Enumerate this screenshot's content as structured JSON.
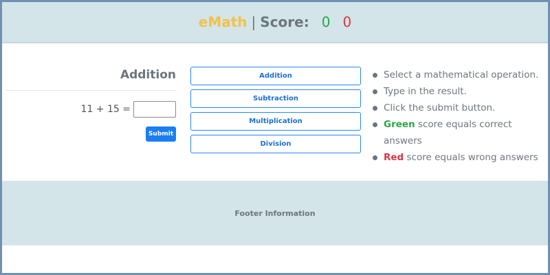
{
  "header": {
    "brand": "eMath",
    "separator": "|",
    "score_label": "Score:",
    "score_correct": "0",
    "score_wrong": "0"
  },
  "exercise": {
    "operation_title": "Addition",
    "problem": "11 + 15 =",
    "answer_value": "",
    "submit_label": "Submit"
  },
  "operations": [
    {
      "label": "Addition"
    },
    {
      "label": "Subtraction"
    },
    {
      "label": "Multiplication"
    },
    {
      "label": "Division"
    }
  ],
  "instructions": {
    "step1": "Select a mathematical operation.",
    "step2": "Type in the result.",
    "step3": "Click the submit button.",
    "green_word": "Green",
    "green_rest": " score equals correct answers",
    "red_word": "Red",
    "red_rest": " score equals wrong answers"
  },
  "footer": {
    "text": "Footer Information"
  },
  "colors": {
    "brand": "#f2c14a",
    "correct": "#28a745",
    "wrong": "#dc3545",
    "accent": "#1a7ef2",
    "band": "#d3e5e8"
  }
}
